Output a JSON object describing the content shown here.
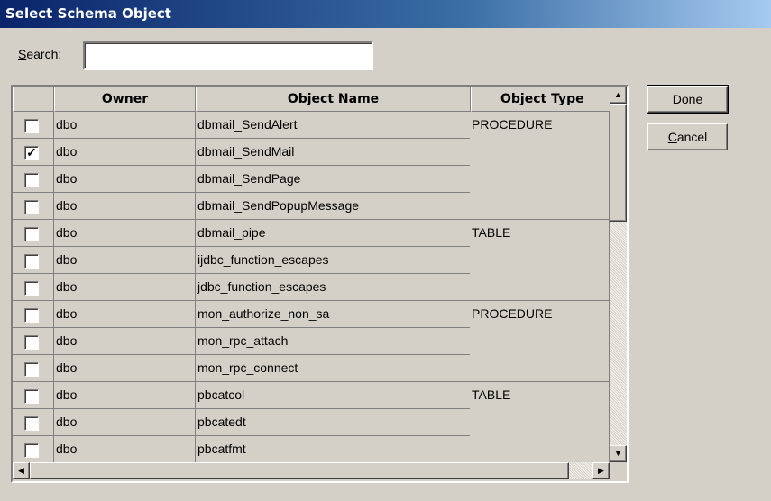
{
  "window": {
    "title": "Select Schema Object"
  },
  "search": {
    "label_mnemonic": "S",
    "label_rest": "earch:",
    "value": ""
  },
  "columns": {
    "owner": "Owner",
    "object_name": "Object Name",
    "object_type": "Object Type"
  },
  "rows": [
    {
      "checked": false,
      "owner": "dbo",
      "name": "dbmail_SendAlert"
    },
    {
      "checked": true,
      "owner": "dbo",
      "name": "dbmail_SendMail"
    },
    {
      "checked": false,
      "owner": "dbo",
      "name": "dbmail_SendPage"
    },
    {
      "checked": false,
      "owner": "dbo",
      "name": "dbmail_SendPopupMessage"
    },
    {
      "checked": false,
      "owner": "dbo",
      "name": "dbmail_pipe"
    },
    {
      "checked": false,
      "owner": "dbo",
      "name": "ijdbc_function_escapes"
    },
    {
      "checked": false,
      "owner": "dbo",
      "name": "jdbc_function_escapes"
    },
    {
      "checked": false,
      "owner": "dbo",
      "name": "mon_authorize_non_sa"
    },
    {
      "checked": false,
      "owner": "dbo",
      "name": "mon_rpc_attach"
    },
    {
      "checked": false,
      "owner": "dbo",
      "name": "mon_rpc_connect"
    },
    {
      "checked": false,
      "owner": "dbo",
      "name": "pbcatcol"
    },
    {
      "checked": false,
      "owner": "dbo",
      "name": "pbcatedt"
    },
    {
      "checked": false,
      "owner": "dbo",
      "name": "pbcatfmt"
    }
  ],
  "type_groups": [
    {
      "label": "PROCEDURE",
      "first_row": 0,
      "span": 4
    },
    {
      "label": "TABLE",
      "first_row": 4,
      "span": 3
    },
    {
      "label": "PROCEDURE",
      "first_row": 7,
      "span": 3
    },
    {
      "label": "TABLE",
      "first_row": 10,
      "span": 3
    }
  ],
  "buttons": {
    "done_mnemonic": "D",
    "done_rest": "one",
    "cancel_mnemonic": "C",
    "cancel_rest": "ancel"
  },
  "icons": {
    "scroll_up": "scroll-up-arrow-icon",
    "scroll_down": "scroll-down-arrow-icon",
    "scroll_left": "scroll-left-arrow-icon",
    "scroll_right": "scroll-right-arrow-icon",
    "check": "checkmark-icon"
  },
  "colors": {
    "title_start": "#0a246a",
    "title_end": "#a6caf0",
    "face": "#d4d0c8"
  }
}
